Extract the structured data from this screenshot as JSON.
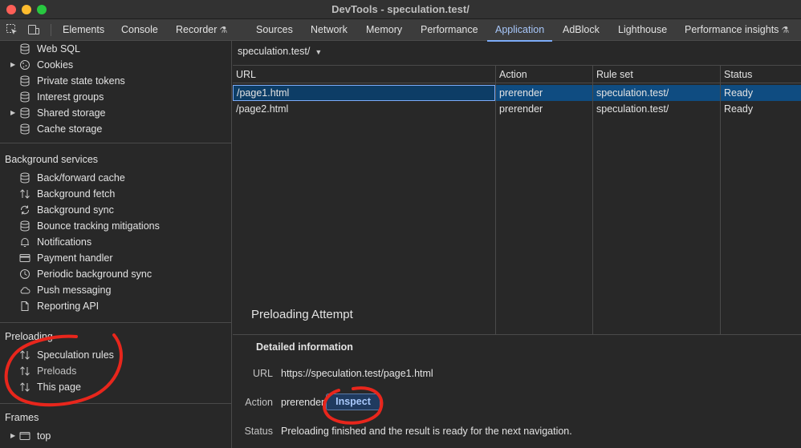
{
  "window": {
    "title": "DevTools - speculation.test/"
  },
  "tabs": [
    {
      "label": "Elements"
    },
    {
      "label": "Console"
    },
    {
      "label": "Recorder"
    },
    {
      "label": "Sources"
    },
    {
      "label": "Network"
    },
    {
      "label": "Memory"
    },
    {
      "label": "Performance"
    },
    {
      "label": "Application",
      "active": true
    },
    {
      "label": "AdBlock"
    },
    {
      "label": "Lighthouse"
    },
    {
      "label": "Performance insights"
    }
  ],
  "sidebar": {
    "storage_items": [
      {
        "label": "Web SQL",
        "icon": "database-icon"
      },
      {
        "label": "Cookies",
        "icon": "cookie-icon",
        "expandable": true
      },
      {
        "label": "Private state tokens",
        "icon": "database-icon"
      },
      {
        "label": "Interest groups",
        "icon": "database-icon"
      },
      {
        "label": "Shared storage",
        "icon": "database-icon",
        "expandable": true
      },
      {
        "label": "Cache storage",
        "icon": "database-icon"
      }
    ],
    "background_services": {
      "header": "Background services",
      "items": [
        {
          "label": "Back/forward cache",
          "icon": "database-icon"
        },
        {
          "label": "Background fetch",
          "icon": "arrows-updown-icon"
        },
        {
          "label": "Background sync",
          "icon": "sync-icon"
        },
        {
          "label": "Bounce tracking mitigations",
          "icon": "database-icon"
        },
        {
          "label": "Notifications",
          "icon": "bell-icon"
        },
        {
          "label": "Payment handler",
          "icon": "card-icon"
        },
        {
          "label": "Periodic background sync",
          "icon": "clock-icon"
        },
        {
          "label": "Push messaging",
          "icon": "cloud-icon"
        },
        {
          "label": "Reporting API",
          "icon": "document-icon"
        }
      ]
    },
    "preloading": {
      "header": "Preloading",
      "items": [
        {
          "label": "Speculation rules",
          "icon": "arrows-updown-icon"
        },
        {
          "label": "Preloads",
          "icon": "arrows-updown-icon"
        },
        {
          "label": "This page",
          "icon": "arrows-updown-icon"
        }
      ]
    },
    "frames": {
      "header": "Frames",
      "items": [
        {
          "label": "top",
          "icon": "frame-icon",
          "expandable": true
        }
      ]
    }
  },
  "main": {
    "ruleset_selector": "speculation.test/",
    "table": {
      "columns": [
        "URL",
        "Action",
        "Rule set",
        "Status"
      ],
      "rows": [
        {
          "url": "/page1.html",
          "action": "prerender",
          "ruleset": "speculation.test/",
          "status": "Ready",
          "selected": true
        },
        {
          "url": "/page2.html",
          "action": "prerender",
          "ruleset": "speculation.test/",
          "status": "Ready"
        }
      ]
    },
    "detail": {
      "title": "Preloading Attempt",
      "subtitle": "Detailed information",
      "url_key": "URL",
      "url_value": "https://speculation.test/page1.html",
      "action_key": "Action",
      "action_value": "prerender",
      "inspect_label": "Inspect",
      "status_key": "Status",
      "status_value": "Preloading finished and the result is ready for the next navigation."
    }
  },
  "colors": {
    "accent": "#7cacf8",
    "selection": "#0f4c81",
    "annotation": "#e8261c"
  }
}
